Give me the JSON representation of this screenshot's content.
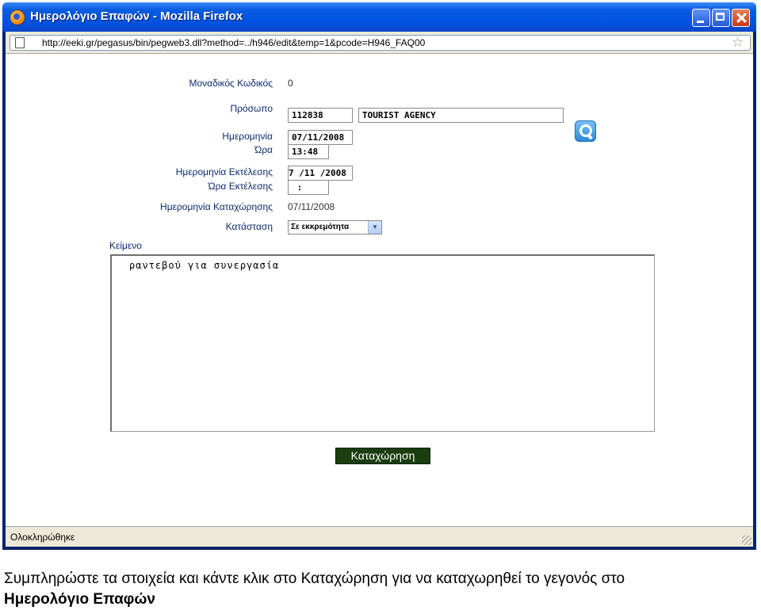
{
  "window": {
    "title": "Ημερολόγιο Επαφών - Mozilla Firefox"
  },
  "address_bar": {
    "url": "http://eeki.gr/pegasus/bin/pegweb3.dll?method=../h946/edit&temp=1&pcode=H946_FAQ00"
  },
  "form": {
    "unique_code": {
      "label": "Μοναδικός Κωδικός",
      "value": "0"
    },
    "person": {
      "label": "Πρόσωπο",
      "code": "112838",
      "name": "TOURIST AGENCY"
    },
    "date": {
      "label": "Ημερομηνία",
      "value": "07/11/2008"
    },
    "time": {
      "label": "Ώρα",
      "value": "13:48"
    },
    "exec_date": {
      "label": "Ημερομηνία Εκτέλεσης",
      "value": "7 /11 /2008"
    },
    "exec_time": {
      "label": "Ώρα Εκτέλεσης",
      "value": " :"
    },
    "reg_date": {
      "label": "Ημερομηνία Καταχώρησης",
      "value": "07/11/2008"
    },
    "status": {
      "label": "Κατάσταση",
      "selected": "Σε εκκρεμότητα"
    },
    "text": {
      "label": "Κείμενο",
      "value": "ραντεβού για συνεργασία"
    },
    "submit_label": "Καταχώρηση"
  },
  "status_bar": {
    "text": "Ολοκληρώθηκε"
  },
  "caption": {
    "line1": "Συμπληρώστε τα στοιχεία και κάντε κλικ στο Καταχώρηση για να καταχωρηθεί το γεγονός στο",
    "line2": "Ημερολόγιο Επαφών"
  },
  "icons": [
    "firefox-icon",
    "page-icon",
    "bookmark-star-icon",
    "search-icon",
    "dropdown-arrow-icon",
    "minimize-icon",
    "maximize-icon",
    "close-icon"
  ]
}
